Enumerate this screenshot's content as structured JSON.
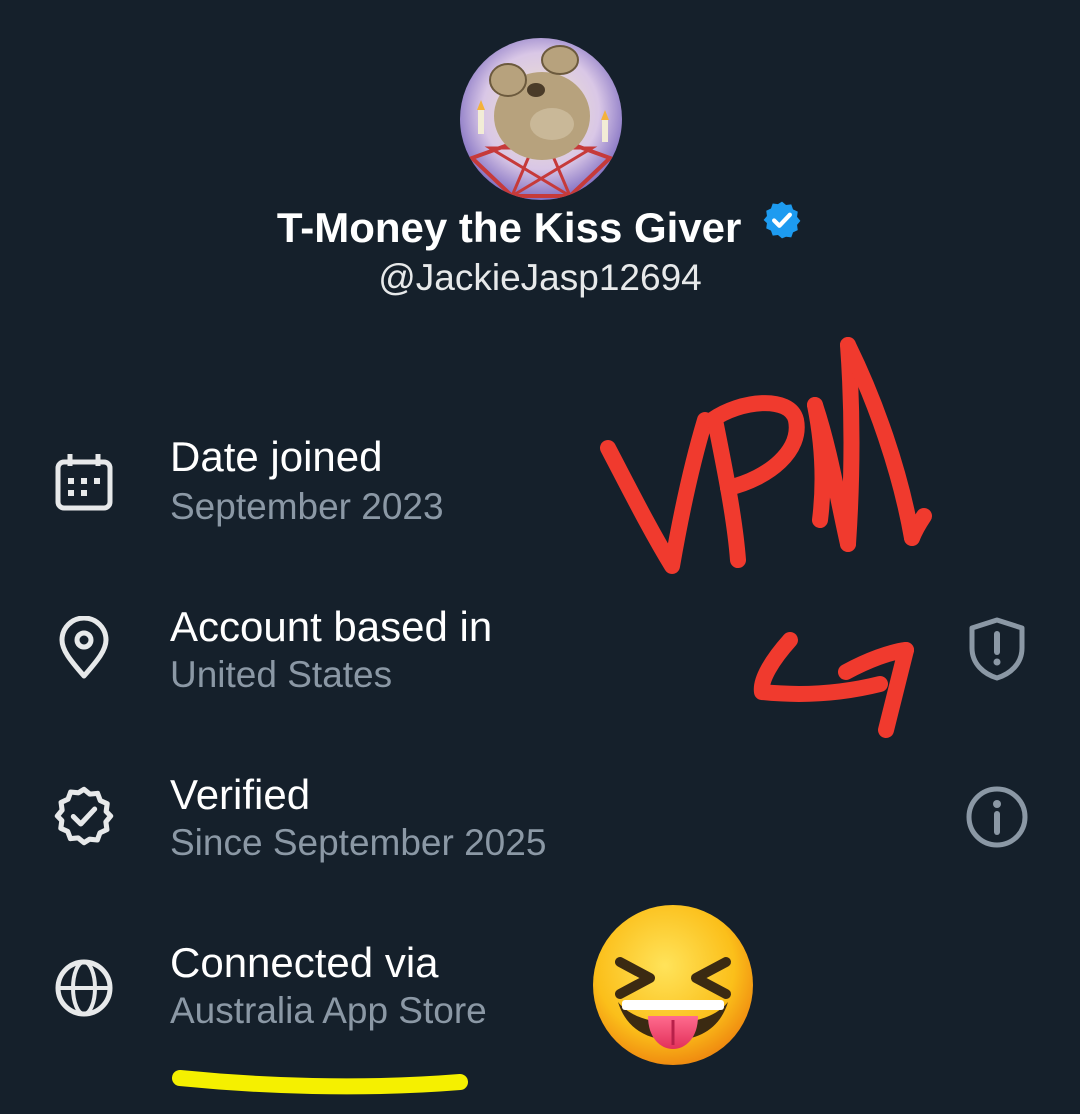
{
  "profile": {
    "display_name": "T-Money the Kiss Giver",
    "handle": "@JackieJasp12694",
    "verified_badge_icon": "verified-checkmark-badge",
    "badge_color": "#1d9bf0"
  },
  "about": [
    {
      "icon": "calendar-icon",
      "title": "Date joined",
      "value": "September 2023"
    },
    {
      "icon": "location-pin-icon",
      "title": "Account based in",
      "value": "United States",
      "right_icon": "shield-alert-icon"
    },
    {
      "icon": "verified-badge-outline-icon",
      "title": "Verified",
      "value": "Since September 2025",
      "right_icon": "info-icon"
    },
    {
      "icon": "globe-icon",
      "title": "Connected via",
      "value": "Australia App Store"
    }
  ],
  "annotations": {
    "handwritten_text": "VPN",
    "ink_color": "#f03a2e",
    "highlight_color": "#f5f000",
    "emoji": "squinting-face-with-tongue"
  },
  "colors": {
    "background": "#15202b",
    "primary_text": "#ffffff",
    "secondary_text": "#8b98a5"
  }
}
